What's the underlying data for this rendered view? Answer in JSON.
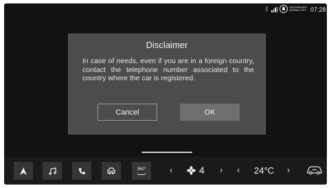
{
  "status": {
    "airbag_line1": "PASSENGER",
    "airbag_line2": "AIRBAG OFF",
    "time": "07:28",
    "icons": [
      "bluetooth-icon",
      "signal-icon",
      "airbag-off-icon"
    ]
  },
  "dialog": {
    "title": "Disclaimer",
    "body": "In case of needs, even if you are in a foreign country, contact the telephone number associated to the country where the car is registered.",
    "cancel_label": "Cancel",
    "ok_label": "OK"
  },
  "bottombar": {
    "tiles": [
      "navigation-icon",
      "music-icon",
      "phone-icon",
      "car-icon"
    ],
    "view360_label": "360°",
    "fan_speed": "4",
    "temperature": "24°C",
    "chevron_left": "‹",
    "chevron_right": "›"
  },
  "colors": {
    "screen_bg": "#111111",
    "dialog_bg": "#4c4c4c",
    "ok_button_bg": "#6e6e6e",
    "tile_bg": "#353535"
  }
}
